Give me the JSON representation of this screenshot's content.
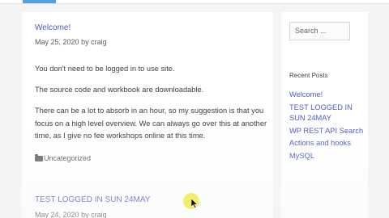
{
  "posts": [
    {
      "title": "Welcome!",
      "date": "May 25, 2020",
      "by": "by",
      "author": "craig",
      "paragraphs": [
        "You don't need to be logged in to use site.",
        "The source code and workbook are downloadable.",
        "There can be a lot to absorb in an hour, so my suggestion is that you focus on a high level overview. We can always go over this at another time, as I give no fee workshops online at this time."
      ],
      "category": "Uncategorized"
    },
    {
      "title": "TEST LOGGED IN SUN 24MAY",
      "date": "May 24, 2020",
      "by": "by",
      "author": "craig"
    }
  ],
  "sidebar": {
    "search_placeholder": "Search ...",
    "recent_title": "Recent Posts",
    "recent_posts": [
      "Welcome!",
      "TEST LOGGED IN SUN 24MAY",
      "WP REST API Search",
      "Actions and hooks",
      "MySQL"
    ]
  },
  "colors": {
    "link": "#4f5bc4",
    "accent": "#5aa0d8",
    "highlight": "#f0e83c"
  },
  "icons": [
    "folder-icon",
    "mouse-pointer-icon"
  ]
}
